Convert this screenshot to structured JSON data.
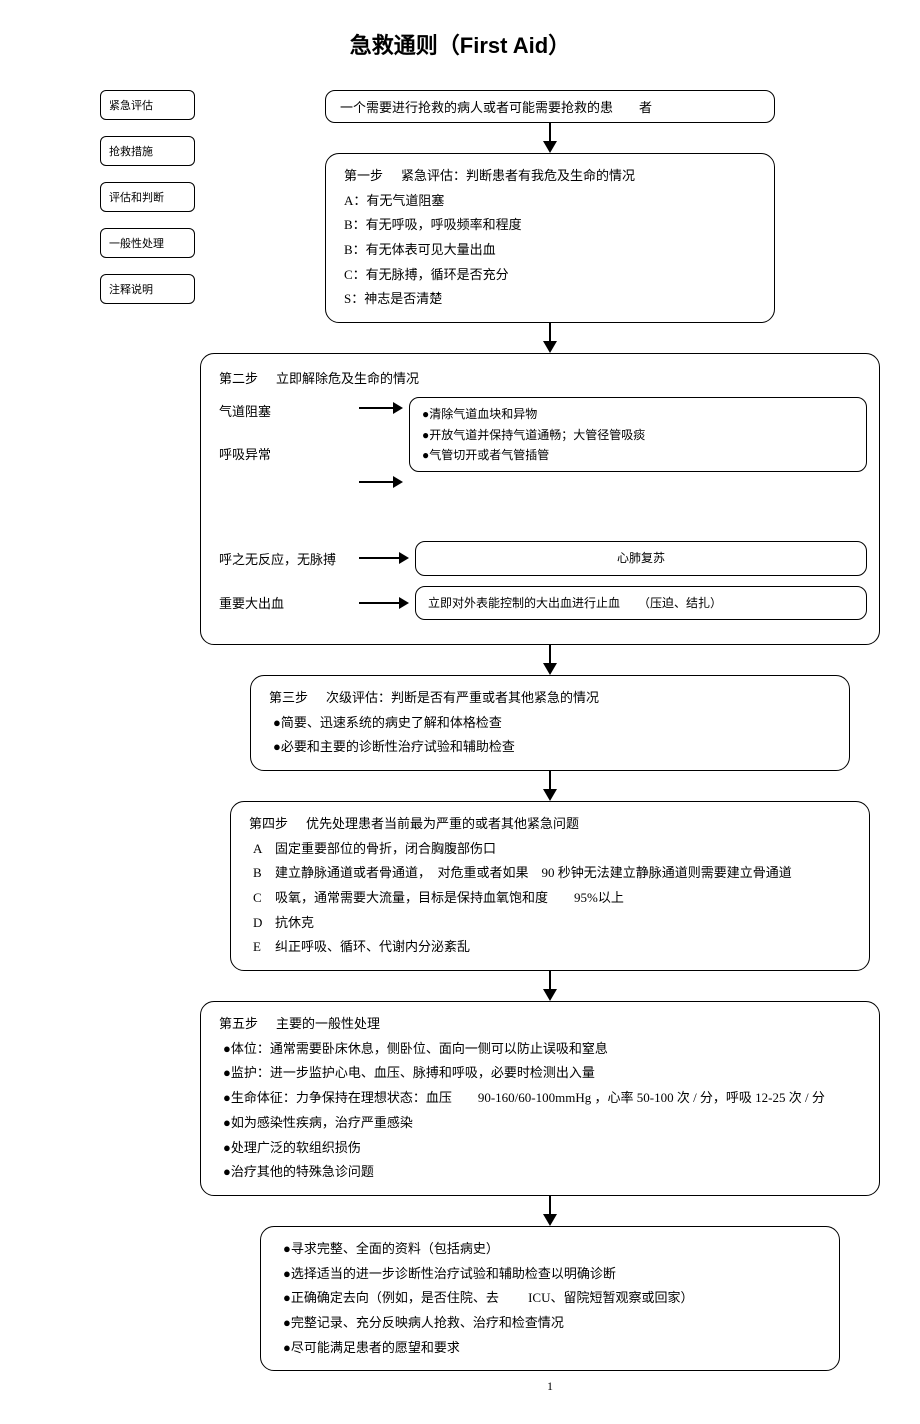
{
  "title_cn": "急救通则（",
  "title_en": "First Aid",
  "title_close": "）",
  "sidebar": {
    "items": [
      {
        "label": "紧急评估"
      },
      {
        "label": "抢救措施"
      },
      {
        "label": "评估和判断"
      },
      {
        "label": "一般性处理"
      },
      {
        "label": "注释说明"
      }
    ]
  },
  "start_box": "一个需要进行抢救的病人或者可能需要抢救的患　　者",
  "step1": {
    "header_step": "第一步",
    "header_text": "紧急评估：判断患者有我危及生命的情况",
    "items": [
      "A：有无气道阻塞",
      "B：有无呼吸，呼吸频率和程度",
      "B：有无体表可见大量出血",
      "C：有无脉搏，循环是否充分",
      "S：神志是否清楚"
    ]
  },
  "step2": {
    "header_step": "第二步",
    "header_text": "立即解除危及生命的情况",
    "row1_label": "气道阻塞",
    "row2_label": "呼吸异常",
    "box1_items": [
      "●清除气道血块和异物",
      "●开放气道并保持气道通畅；大管径管吸痰",
      "●气管切开或者气管插管"
    ],
    "row3_label": "呼之无反应，无脉搏",
    "box3_text": "心肺复苏",
    "row4_label": "重要大出血",
    "box4_text": "立即对外表能控制的大出血进行止血　　（压迫、结扎）"
  },
  "step3": {
    "header_step": "第三步",
    "header_text": "次级评估：判断是否有严重或者其他紧急的情况",
    "items": [
      "●简要、迅速系统的病史了解和体格检查",
      "●必要和主要的诊断性治疗试验和辅助检查"
    ]
  },
  "step4": {
    "header_step": "第四步",
    "header_text": "优先处理患者当前最为严重的或者其他紧急问题",
    "items": [
      {
        "letter": "A",
        "text": "固定重要部位的骨折，闭合胸腹部伤口"
      },
      {
        "letter": "B",
        "text": "建立静脉通道或者骨通道，　对危重或者如果　90 秒钟无法建立静脉通道则需要建立骨通道"
      },
      {
        "letter": "C",
        "text": "吸氧，通常需要大流量，目标是保持血氧饱和度　　95%以上"
      },
      {
        "letter": "D",
        "text": "抗休克"
      },
      {
        "letter": "E",
        "text": "纠正呼吸、循环、代谢内分泌紊乱"
      }
    ]
  },
  "step5": {
    "header_step": "第五步",
    "header_text": "主要的一般性处理",
    "items": [
      "●体位：通常需要卧床休息，侧卧位、面向一侧可以防止误吸和窒息",
      "●监护：进一步监护心电、血压、脉搏和呼吸，必要时检测出入量",
      "●生命体征：力争保持在理想状态：血压　　90-160/60-100mmHg ，心率  50-100 次 / 分，呼吸   12-25 次 / 分",
      "●如为感染性疾病，治疗严重感染",
      "●处理广泛的软组织损伤",
      "●治疗其他的特殊急诊问题"
    ]
  },
  "final": {
    "items": [
      "●寻求完整、全面的资料（包括病史）",
      "●选择适当的进一步诊断性治疗试验和辅助检查以明确诊断",
      "●正确确定去向（例如，是否住院、去　　 ICU、留院短暂观察或回家）",
      "●完整记录、充分反映病人抢救、治疗和检查情况",
      "●尽可能满足患者的愿望和要求"
    ]
  },
  "page_num": "1"
}
